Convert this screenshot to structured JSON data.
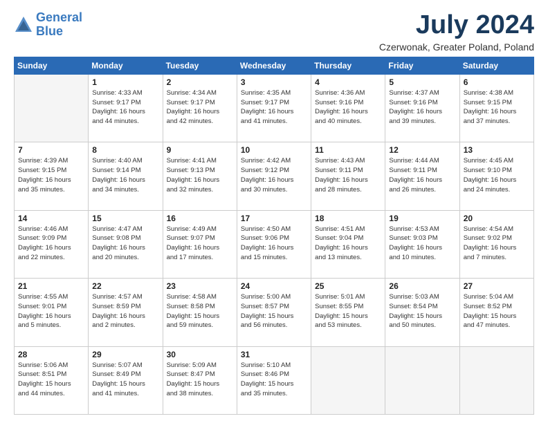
{
  "logo": {
    "line1": "General",
    "line2": "Blue"
  },
  "title": "July 2024",
  "subtitle": "Czerwonak, Greater Poland, Poland",
  "headers": [
    "Sunday",
    "Monday",
    "Tuesday",
    "Wednesday",
    "Thursday",
    "Friday",
    "Saturday"
  ],
  "weeks": [
    [
      {
        "day": "",
        "info": ""
      },
      {
        "day": "1",
        "info": "Sunrise: 4:33 AM\nSunset: 9:17 PM\nDaylight: 16 hours\nand 44 minutes."
      },
      {
        "day": "2",
        "info": "Sunrise: 4:34 AM\nSunset: 9:17 PM\nDaylight: 16 hours\nand 42 minutes."
      },
      {
        "day": "3",
        "info": "Sunrise: 4:35 AM\nSunset: 9:17 PM\nDaylight: 16 hours\nand 41 minutes."
      },
      {
        "day": "4",
        "info": "Sunrise: 4:36 AM\nSunset: 9:16 PM\nDaylight: 16 hours\nand 40 minutes."
      },
      {
        "day": "5",
        "info": "Sunrise: 4:37 AM\nSunset: 9:16 PM\nDaylight: 16 hours\nand 39 minutes."
      },
      {
        "day": "6",
        "info": "Sunrise: 4:38 AM\nSunset: 9:15 PM\nDaylight: 16 hours\nand 37 minutes."
      }
    ],
    [
      {
        "day": "7",
        "info": "Sunrise: 4:39 AM\nSunset: 9:15 PM\nDaylight: 16 hours\nand 35 minutes."
      },
      {
        "day": "8",
        "info": "Sunrise: 4:40 AM\nSunset: 9:14 PM\nDaylight: 16 hours\nand 34 minutes."
      },
      {
        "day": "9",
        "info": "Sunrise: 4:41 AM\nSunset: 9:13 PM\nDaylight: 16 hours\nand 32 minutes."
      },
      {
        "day": "10",
        "info": "Sunrise: 4:42 AM\nSunset: 9:12 PM\nDaylight: 16 hours\nand 30 minutes."
      },
      {
        "day": "11",
        "info": "Sunrise: 4:43 AM\nSunset: 9:11 PM\nDaylight: 16 hours\nand 28 minutes."
      },
      {
        "day": "12",
        "info": "Sunrise: 4:44 AM\nSunset: 9:11 PM\nDaylight: 16 hours\nand 26 minutes."
      },
      {
        "day": "13",
        "info": "Sunrise: 4:45 AM\nSunset: 9:10 PM\nDaylight: 16 hours\nand 24 minutes."
      }
    ],
    [
      {
        "day": "14",
        "info": "Sunrise: 4:46 AM\nSunset: 9:09 PM\nDaylight: 16 hours\nand 22 minutes."
      },
      {
        "day": "15",
        "info": "Sunrise: 4:47 AM\nSunset: 9:08 PM\nDaylight: 16 hours\nand 20 minutes."
      },
      {
        "day": "16",
        "info": "Sunrise: 4:49 AM\nSunset: 9:07 PM\nDaylight: 16 hours\nand 17 minutes."
      },
      {
        "day": "17",
        "info": "Sunrise: 4:50 AM\nSunset: 9:06 PM\nDaylight: 16 hours\nand 15 minutes."
      },
      {
        "day": "18",
        "info": "Sunrise: 4:51 AM\nSunset: 9:04 PM\nDaylight: 16 hours\nand 13 minutes."
      },
      {
        "day": "19",
        "info": "Sunrise: 4:53 AM\nSunset: 9:03 PM\nDaylight: 16 hours\nand 10 minutes."
      },
      {
        "day": "20",
        "info": "Sunrise: 4:54 AM\nSunset: 9:02 PM\nDaylight: 16 hours\nand 7 minutes."
      }
    ],
    [
      {
        "day": "21",
        "info": "Sunrise: 4:55 AM\nSunset: 9:01 PM\nDaylight: 16 hours\nand 5 minutes."
      },
      {
        "day": "22",
        "info": "Sunrise: 4:57 AM\nSunset: 8:59 PM\nDaylight: 16 hours\nand 2 minutes."
      },
      {
        "day": "23",
        "info": "Sunrise: 4:58 AM\nSunset: 8:58 PM\nDaylight: 15 hours\nand 59 minutes."
      },
      {
        "day": "24",
        "info": "Sunrise: 5:00 AM\nSunset: 8:57 PM\nDaylight: 15 hours\nand 56 minutes."
      },
      {
        "day": "25",
        "info": "Sunrise: 5:01 AM\nSunset: 8:55 PM\nDaylight: 15 hours\nand 53 minutes."
      },
      {
        "day": "26",
        "info": "Sunrise: 5:03 AM\nSunset: 8:54 PM\nDaylight: 15 hours\nand 50 minutes."
      },
      {
        "day": "27",
        "info": "Sunrise: 5:04 AM\nSunset: 8:52 PM\nDaylight: 15 hours\nand 47 minutes."
      }
    ],
    [
      {
        "day": "28",
        "info": "Sunrise: 5:06 AM\nSunset: 8:51 PM\nDaylight: 15 hours\nand 44 minutes."
      },
      {
        "day": "29",
        "info": "Sunrise: 5:07 AM\nSunset: 8:49 PM\nDaylight: 15 hours\nand 41 minutes."
      },
      {
        "day": "30",
        "info": "Sunrise: 5:09 AM\nSunset: 8:47 PM\nDaylight: 15 hours\nand 38 minutes."
      },
      {
        "day": "31",
        "info": "Sunrise: 5:10 AM\nSunset: 8:46 PM\nDaylight: 15 hours\nand 35 minutes."
      },
      {
        "day": "",
        "info": ""
      },
      {
        "day": "",
        "info": ""
      },
      {
        "day": "",
        "info": ""
      }
    ]
  ]
}
